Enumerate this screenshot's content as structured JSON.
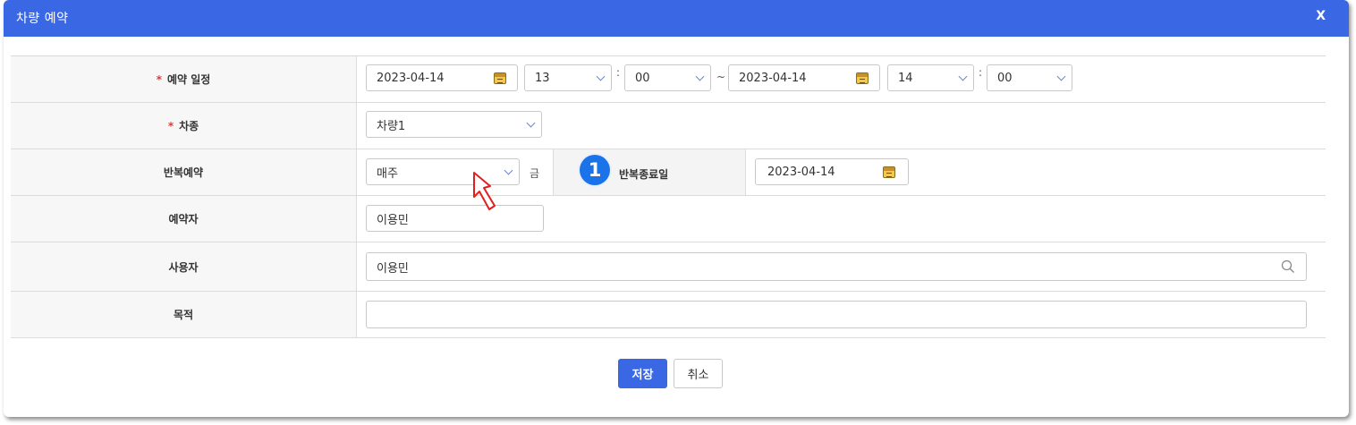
{
  "dialog": {
    "title": "차량 예약",
    "close_label": "X"
  },
  "form": {
    "schedule": {
      "label": "예약 일정",
      "required_mark": "*",
      "start_date": "2023-04-14",
      "start_hour": "13",
      "start_minute": "00",
      "time_colon": ":",
      "range_sep": "~",
      "end_date": "2023-04-14",
      "end_hour": "14",
      "end_minute": "00"
    },
    "vehicle_type": {
      "label": "차종",
      "required_mark": "*",
      "value": "차량1"
    },
    "repeat": {
      "label": "반복예약",
      "value": "매주",
      "weekday": "금",
      "end_label": "반복종료일",
      "end_date": "2023-04-14",
      "step_badge": "1"
    },
    "reserver": {
      "label": "예약자",
      "value": "이용민"
    },
    "user": {
      "label": "사용자",
      "value": "이용민"
    },
    "purpose": {
      "label": "목적",
      "value": ""
    }
  },
  "buttons": {
    "save": "저장",
    "cancel": "취소"
  },
  "icons": {
    "calendar": "calendar-icon",
    "search": "search-icon",
    "chevron": "chevron-down-icon",
    "cursor": "cursor-arrow-icon"
  },
  "colors": {
    "titlebar": "#3a68e4",
    "required": "#e53935",
    "badge": "#1a73e8",
    "cursor_outline": "#e02020"
  }
}
